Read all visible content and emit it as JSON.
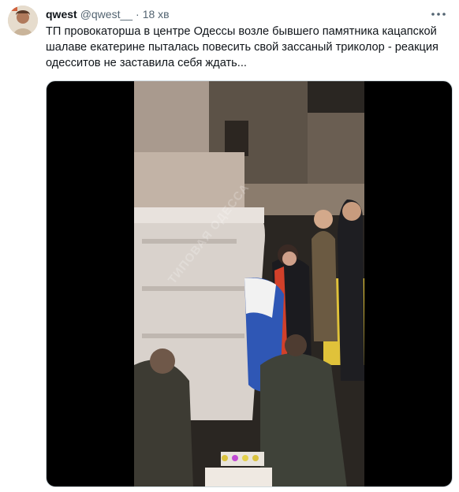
{
  "tweet": {
    "author_name": "qwest",
    "author_handle": "@qwest__",
    "separator": "·",
    "time": "18 хв",
    "text": "ТП провокаторша в центре Одессы возле бывшего памятника кацапской шалаве екатерине пыталась повесить свой зассаный триколор - реакция одесситов не заставила себя ждать...",
    "more_icon": "ellipsis-icon"
  },
  "media": {
    "watermark": "ТИПОВАЯ ОДЕССА"
  }
}
